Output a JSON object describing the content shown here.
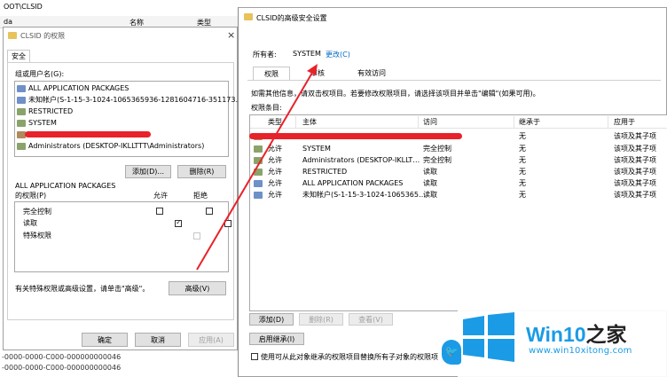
{
  "background": {
    "path": "OOT\\CLSID",
    "col_name": "名称",
    "col_type": "类型",
    "left_da": "da",
    "bottom_text_1": "-0000-0000-C000-000000000046",
    "bottom_text_2": "-0000-0000-C000-000000000046"
  },
  "perm_dialog": {
    "title": "CLSID 的权限",
    "tab_security": "安全",
    "group_label": "组或用户名(G):",
    "users": [
      "ALL APPLICATION PACKAGES",
      "未知帐户(S-1-15-3-1024-1065365936-1281604716-351173…",
      "RESTRICTED",
      "SYSTEM",
      "",
      "Administrators (DESKTOP-IKLLTTT\\Administrators)"
    ],
    "add_btn": "添加(D)...",
    "remove_btn": "删除(R)",
    "perm_for": "ALL APPLICATION PACKAGES",
    "perm_for2": "的权限(P)",
    "allow": "允许",
    "deny": "拒绝",
    "permissions": [
      {
        "name": "完全控制",
        "allow": false,
        "deny": false,
        "disabled": false
      },
      {
        "name": "读取",
        "allow": true,
        "deny": false,
        "disabled": false
      },
      {
        "name": "特殊权限",
        "allow": false,
        "deny": false,
        "disabled": true
      }
    ],
    "advanced_hint": "有关特殊权限或高级设置，请单击\"高级\"。",
    "advanced_btn": "高级(V)",
    "ok_btn": "确定",
    "cancel_btn": "取消",
    "apply_btn": "应用(A)"
  },
  "adv_dialog": {
    "title": "CLSID的高级安全设置",
    "owner_label": "所有者:",
    "owner_value": "SYSTEM",
    "change_link": "更改(C)",
    "tabs": [
      "权限",
      "审核",
      "有效访问"
    ],
    "info_text": "如需其他信息，请双击权项目。若要修改权限项目，请选择该项目并单击\"编辑\"(如果可用)。",
    "entries_label": "权限条目:",
    "columns": [
      "类型",
      "主体",
      "访问",
      "继承于",
      "应用于"
    ],
    "rows": [
      {
        "type": "",
        "principal": "",
        "access": "",
        "inherit": "无",
        "apply": "该项及其子项"
      },
      {
        "type": "允许",
        "principal": "SYSTEM",
        "access": "完全控制",
        "inherit": "无",
        "apply": "该项及其子项"
      },
      {
        "type": "允许",
        "principal": "Administrators (DESKTOP-IKLLT…",
        "access": "完全控制",
        "inherit": "无",
        "apply": "该项及其子项"
      },
      {
        "type": "允许",
        "principal": "RESTRICTED",
        "access": "读取",
        "inherit": "无",
        "apply": "该项及其子项"
      },
      {
        "type": "允许",
        "principal": "ALL APPLICATION PACKAGES",
        "access": "读取",
        "inherit": "无",
        "apply": "该项及其子项"
      },
      {
        "type": "允许",
        "principal": "未知帐户(S-1-15-3-1024-1065365…",
        "access": "读取",
        "inherit": "无",
        "apply": "该项及其子项"
      }
    ],
    "add_btn": "添加(D)",
    "remove_btn": "删除(R)",
    "view_btn": "查看(V)",
    "enable_inherit_btn": "启用继承(I)",
    "replace_text": "使用可从此对象继承的权限项目替换所有子对象的权限项"
  },
  "watermark": {
    "brand_a": "Win10",
    "brand_b": "之家",
    "url": "www.win10xitong.com"
  },
  "colors": {
    "accent_blue": "#0067c0",
    "annotation_red": "#e8222a",
    "win_blue": "#1b9be6"
  }
}
